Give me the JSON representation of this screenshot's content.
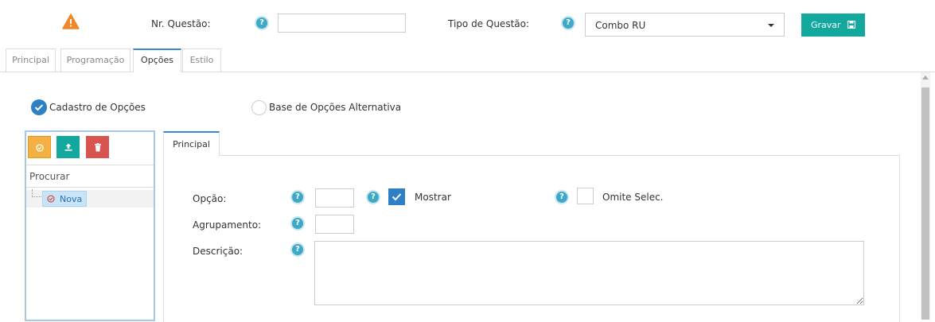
{
  "header": {
    "warning_icon": "warning-triangle-icon",
    "nr_label": "Nr. Questão:",
    "nr_value": "",
    "tipo_label": "Tipo de Questão:",
    "tipo_value": "Combo RU",
    "save_label": "Gravar",
    "help_glyph": "?"
  },
  "tabs": [
    "Principal",
    "Programação",
    "Opções",
    "Estilo"
  ],
  "active_tab": "Opções",
  "options_mode": {
    "cadastro_label": "Cadastro de Opções",
    "cadastro_selected": true,
    "base_label": "Base de Opções Alternativa",
    "base_selected": false
  },
  "tree": {
    "search_placeholder": "Procurar",
    "node_label": "Nova",
    "toolbar_icons": [
      "check-circle-icon",
      "upload-icon",
      "trash-icon"
    ]
  },
  "detail": {
    "tab_label": "Principal",
    "opcao_label": "Opção:",
    "opcao_value": "",
    "mostrar_label": "Mostrar",
    "mostrar_checked": true,
    "omite_label": "Omite Selec.",
    "omite_checked": false,
    "agrupamento_label": "Agrupamento:",
    "agrupamento_value": "",
    "descricao_label": "Descrição:",
    "descricao_value": ""
  },
  "colors": {
    "accent_teal": "#12a89d",
    "help_blue": "#3ea9c7",
    "check_blue": "#2d7fc6",
    "warning_orange": "#f0882b",
    "btn_orange": "#f4b143",
    "btn_red": "#d9534f"
  }
}
